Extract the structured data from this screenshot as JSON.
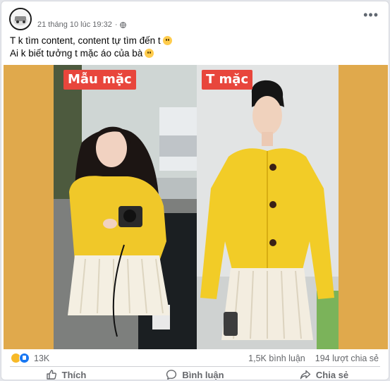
{
  "post": {
    "timestamp": "21 tháng 10 lúc 19:32",
    "audience_icon": "globe-icon",
    "more_icon": "more-dots-icon",
    "more_label": "•••",
    "caption_line1": "T k tìm content, content tự tìm đến t",
    "caption_line2": "Ai k biết tưởng t mặc áo của bà"
  },
  "media": {
    "left_tag": "Mẫu mặc",
    "right_tag": "T mặc"
  },
  "stats": {
    "reaction_count": "13K",
    "comments": "1,5K bình luận",
    "shares": "194 lượt chia sẻ"
  },
  "actions": {
    "like": "Thích",
    "comment": "Bình luận",
    "share": "Chia sẻ"
  },
  "colors": {
    "background": "#e0a94c",
    "tag": "#e8463c",
    "cardigan": "#f2cc27",
    "like_blue": "#1877f2"
  }
}
